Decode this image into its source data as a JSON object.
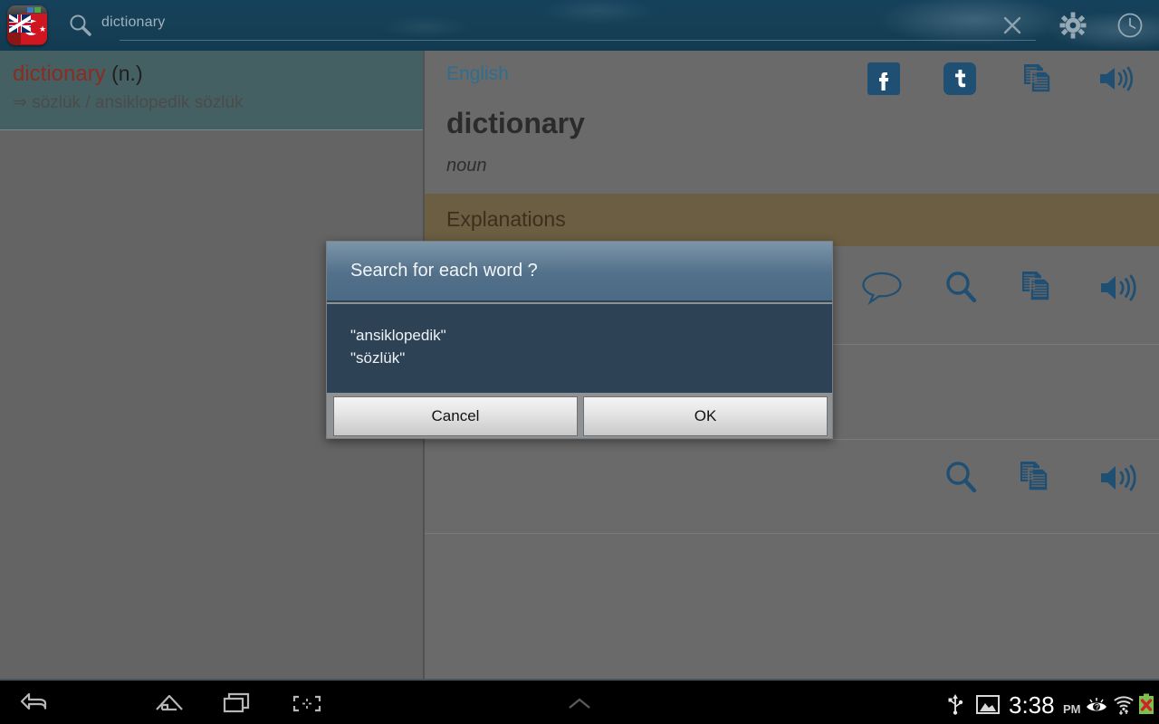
{
  "app": {
    "logo_name": "english-turkish-dictionary-logo"
  },
  "search": {
    "value": "dictionary",
    "placeholder": "dictionary",
    "icon": "search-icon",
    "clear_icon": "close-icon",
    "settings_icon": "gear-icon",
    "history_icon": "clock-icon"
  },
  "results": {
    "items": [
      {
        "headword": "dictionary",
        "pos": " (n.)",
        "translation": "⇒ sözlük / ansiklopedik sözlük"
      }
    ]
  },
  "entry": {
    "language": "English",
    "word": "dictionary",
    "part_of_speech": "noun",
    "section_header": "Explanations",
    "actions": [
      {
        "name": "facebook-icon",
        "label": "f"
      },
      {
        "name": "twitter-icon",
        "label": "t"
      },
      {
        "name": "copy-icon",
        "label": "copy"
      },
      {
        "name": "speaker-icon",
        "label": "speak"
      }
    ],
    "row_actions": [
      {
        "name": "comment-icon"
      },
      {
        "name": "search-icon"
      },
      {
        "name": "copy-icon"
      },
      {
        "name": "speaker-icon"
      }
    ],
    "row_actions_secondary": [
      {
        "name": "search-icon"
      },
      {
        "name": "copy-icon"
      },
      {
        "name": "speaker-icon"
      }
    ]
  },
  "dialog": {
    "title": "Search for each word ?",
    "lines": [
      "\"ansiklopedik\"",
      "\"sözlük\""
    ],
    "cancel_label": "Cancel",
    "ok_label": "OK"
  },
  "navbar": {
    "back_icon": "back-icon",
    "home_icon": "home-icon",
    "recent_icon": "recent-apps-icon",
    "screenshot_icon": "screenshot-icon",
    "menu_icon": "chevron-up-icon"
  },
  "status": {
    "time": "3:38",
    "ampm": "PM",
    "usb_icon": "usb-icon",
    "image_icon": "image-icon",
    "eye_icon": "eye-icon",
    "wifi_icon": "wifi-icon",
    "battery_icon": "battery-error-icon"
  },
  "colors": {
    "topbar": "#16415c",
    "accent_blue": "#2f6e8f",
    "headword_red": "#8c2b22",
    "explanations_brown": "#6b5e42",
    "dialog_body": "#2e4256",
    "icon_blue": "#1f4f72"
  }
}
